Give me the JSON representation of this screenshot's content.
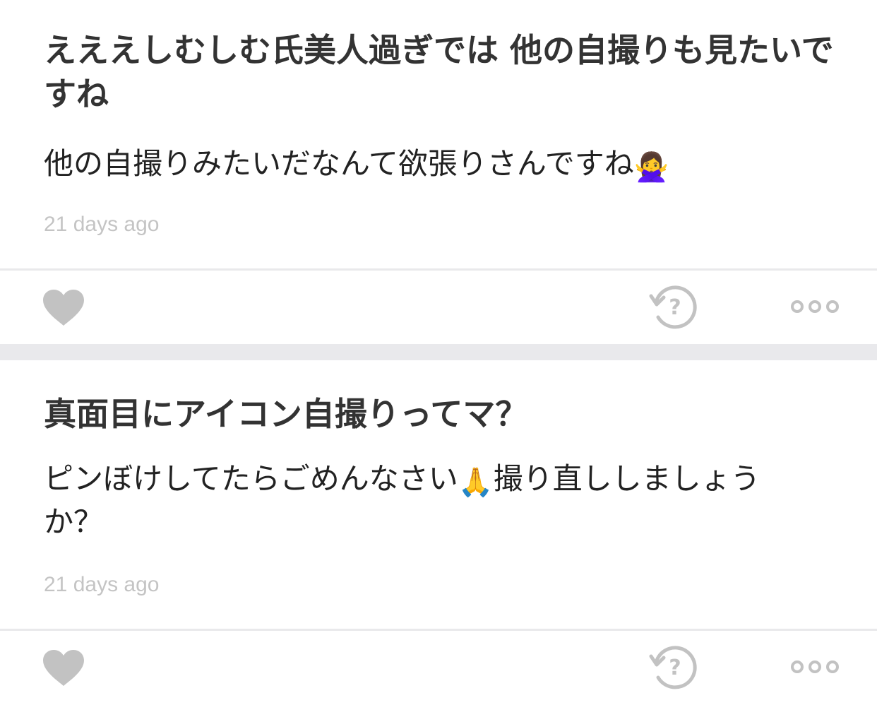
{
  "posts": [
    {
      "question": "えええしむしむ氏美人過ぎでは 他の自撮りも見たいですね",
      "answer": "他の自撮りみたいだなんて欲張りさんですね",
      "answer_emoji": "🙅‍♀️",
      "timestamp": "21 days ago",
      "actions": [
        "heart-icon",
        "retry-question-icon",
        "more-options-icon"
      ]
    },
    {
      "question": "真面目にアイコン自撮りってマ？",
      "answer_part1": "ピンぼけしてたらごめんなさい",
      "answer_emoji": "🙏",
      "answer_part2": "撮り直ししましょうか？",
      "timestamp": "21 days ago",
      "actions": [
        "heart-icon",
        "retry-question-icon",
        "more-options-icon"
      ]
    }
  ],
  "colors": {
    "icon_gray": "#c2c2c2",
    "divider": "#e9e9eb",
    "timestamp": "#c4c4c4",
    "separator_band": "#e9e9ec"
  }
}
